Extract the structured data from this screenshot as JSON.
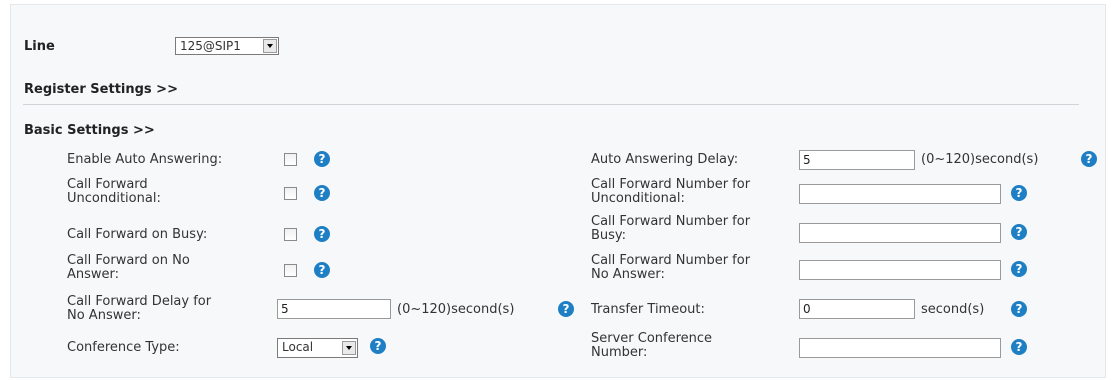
{
  "line": {
    "label": "Line",
    "value": "125@SIP1"
  },
  "sections": {
    "register": "Register Settings >>",
    "basic": "Basic Settings >>"
  },
  "help_glyph": "?",
  "left": {
    "auto_answer": {
      "label": "Enable Auto Answering:"
    },
    "cf_uncond": {
      "label1": "Call Forward",
      "label2": "Unconditional:"
    },
    "cf_busy": {
      "label": "Call Forward on Busy:"
    },
    "cf_noans": {
      "label1": "Call Forward on No",
      "label2": "Answer:"
    },
    "cf_delay": {
      "label1": "Call Forward Delay for",
      "label2": "No Answer:",
      "value": "5",
      "unit": "(0~120)second(s)"
    },
    "conf_type": {
      "label": "Conference Type:",
      "value": "Local"
    }
  },
  "right": {
    "auto_delay": {
      "label": "Auto Answering Delay:",
      "value": "5",
      "unit": "(0~120)second(s)"
    },
    "num_uncond": {
      "label1": "Call Forward Number for",
      "label2": "Unconditional:",
      "value": ""
    },
    "num_busy": {
      "label1": "Call Forward Number for",
      "label2": "Busy:",
      "value": ""
    },
    "num_noans": {
      "label1": "Call Forward Number for",
      "label2": "No Answer:",
      "value": ""
    },
    "transfer": {
      "label": "Transfer Timeout:",
      "value": "0",
      "unit": "second(s)"
    },
    "server_conf": {
      "label1": "Server Conference",
      "label2": "Number:",
      "value": ""
    }
  },
  "colors": {
    "help_icon": "#1f7fc4",
    "panel_bg": "#f6f8fa",
    "divider": "#cfd4d9"
  }
}
